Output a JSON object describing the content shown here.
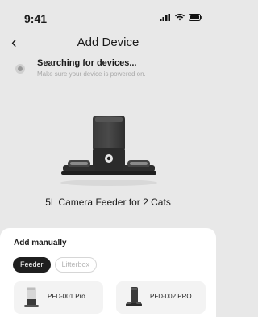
{
  "status_bar": {
    "time": "9:41",
    "icons": [
      "signal-icon",
      "wifi-icon",
      "battery-icon"
    ]
  },
  "nav": {
    "back_icon": "‹",
    "title": "Add Device"
  },
  "search": {
    "title": "Searching for devices...",
    "subtitle": "Make sure your device is powered on."
  },
  "found_device": {
    "name": "5L Camera Feeder for 2 Cats"
  },
  "manual": {
    "title": "Add manually",
    "tabs": [
      {
        "label": "Feeder",
        "active": true
      },
      {
        "label": "Litterbox",
        "active": false
      }
    ],
    "products": [
      {
        "label": "PFD-001 Pro..."
      },
      {
        "label": "PFD-002 PRO..."
      }
    ]
  },
  "colors": {
    "background": "#e8e8e8",
    "sheet": "#ffffff",
    "active_tab": "#1f1f1f"
  }
}
